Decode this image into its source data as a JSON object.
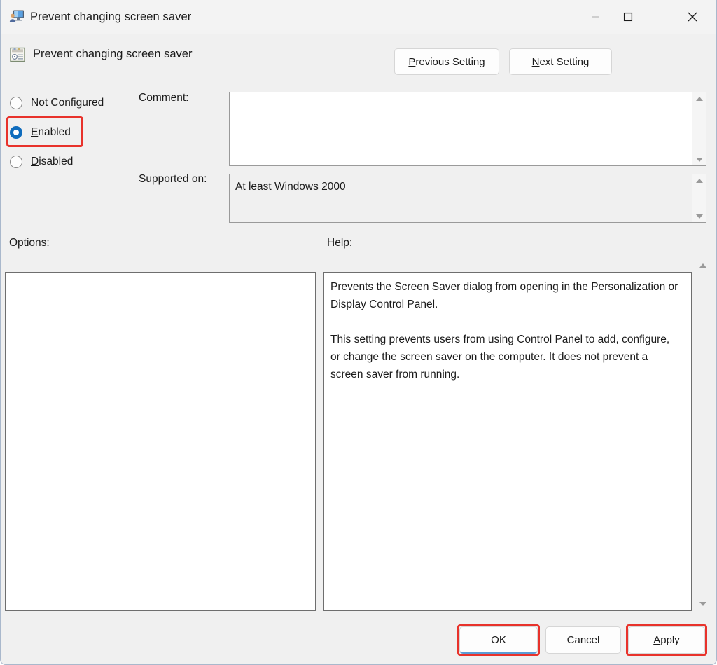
{
  "window": {
    "title": "Prevent changing screen saver",
    "title_icon": "user-monitor-icon",
    "controls": {
      "minimize": "minimize-icon",
      "maximize": "maximize-icon",
      "close": "close-icon"
    }
  },
  "header": {
    "policy_icon": "policy-setting-icon",
    "policy_name": "Prevent changing screen saver",
    "previous_setting": {
      "accel": "P",
      "rest": "revious Setting"
    },
    "next_setting": {
      "accel": "N",
      "rest": "ext Setting"
    }
  },
  "state": {
    "options": [
      {
        "id": "not-configured",
        "accel_before": "Not C",
        "accel": "o",
        "accel_after": "nfigured",
        "selected": false
      },
      {
        "id": "enabled",
        "accel_before": "",
        "accel": "E",
        "accel_after": "nabled",
        "selected": true
      },
      {
        "id": "disabled",
        "accel_before": "",
        "accel": "D",
        "accel_after": "isabled",
        "selected": false
      }
    ],
    "selected": "enabled"
  },
  "comment": {
    "label": "Comment:",
    "value": "",
    "placeholder": ""
  },
  "supported_on": {
    "label": "Supported on:",
    "value": "At least Windows 2000"
  },
  "options_pane": {
    "label": "Options:",
    "content": ""
  },
  "help_pane": {
    "label": "Help:",
    "paragraphs": [
      "Prevents the Screen Saver dialog from opening in the Personalization or Display Control Panel.",
      "This setting prevents users from using Control Panel to add, configure, or change the screen saver on the computer. It does not prevent a screen saver from running."
    ]
  },
  "footer": {
    "ok": "OK",
    "cancel": "Cancel",
    "apply": {
      "accel": "A",
      "rest": "pply"
    }
  },
  "annotations": {
    "highlight_color": "#e8322b",
    "highlighted": [
      "enabled-radio",
      "ok-button",
      "apply-button"
    ]
  },
  "colors": {
    "accent": "#0f6cbd",
    "window_background": "#f0f0f0",
    "titlebar_background": "#f3f3f3",
    "field_background": "#ffffff",
    "readonly_field_background": "#f0f0f0",
    "border": "#a9b8cc"
  }
}
